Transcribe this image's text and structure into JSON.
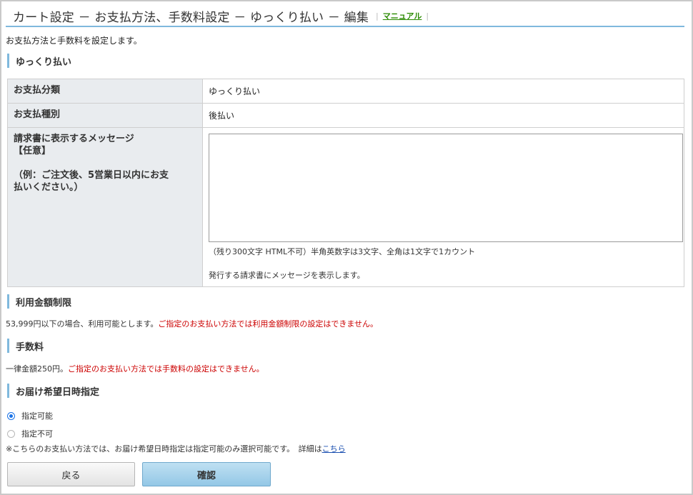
{
  "header": {
    "title": "カート設定 － お支払方法、手数料設定 － ゆっくり払い － 編集",
    "manual_link": "マニュアル",
    "separator": "|"
  },
  "intro": "お支払方法と手数料を設定します。",
  "sections": {
    "payment": "ゆっくり払い",
    "limit": "利用金額制限",
    "fee": "手数料",
    "delivery": "お届け希望日時指定"
  },
  "table": {
    "category_label": "お支払分類",
    "category_value": "ゆっくり払い",
    "type_label": "お支払種別",
    "type_value": "後払い",
    "message_label_1": "請求書に表示するメッセージ",
    "message_label_2": "【任意】",
    "message_example_1": "（例：ご注文後、5営業日以内にお支",
    "message_example_2": "払いください。）",
    "message_value": "",
    "message_note_1": "（残り300文字 HTML不可）半角英数字は3文字、全角は1文字で1カウント",
    "message_note_2": "発行する請求書にメッセージを表示します。"
  },
  "limit": {
    "text": "53,999円以下の場合、利用可能とします。",
    "warning": "ご指定のお支払い方法では利用金額制限の設定はできません。"
  },
  "fee": {
    "text": "一律金額250円。",
    "warning": "ご指定のお支払い方法では手数料の設定はできません。"
  },
  "delivery": {
    "option_on": "指定可能",
    "option_off": "指定不可",
    "note": "※こちらのお支払い方法では、お届け希望日時指定は指定可能のみ選択可能です。　詳細は",
    "note_link": "こちら"
  },
  "buttons": {
    "back": "戻る",
    "confirm": "確認"
  },
  "colors": {
    "accent": "#7fb9dd",
    "warning": "#cc0000",
    "manual_link": "#2a8a00"
  }
}
